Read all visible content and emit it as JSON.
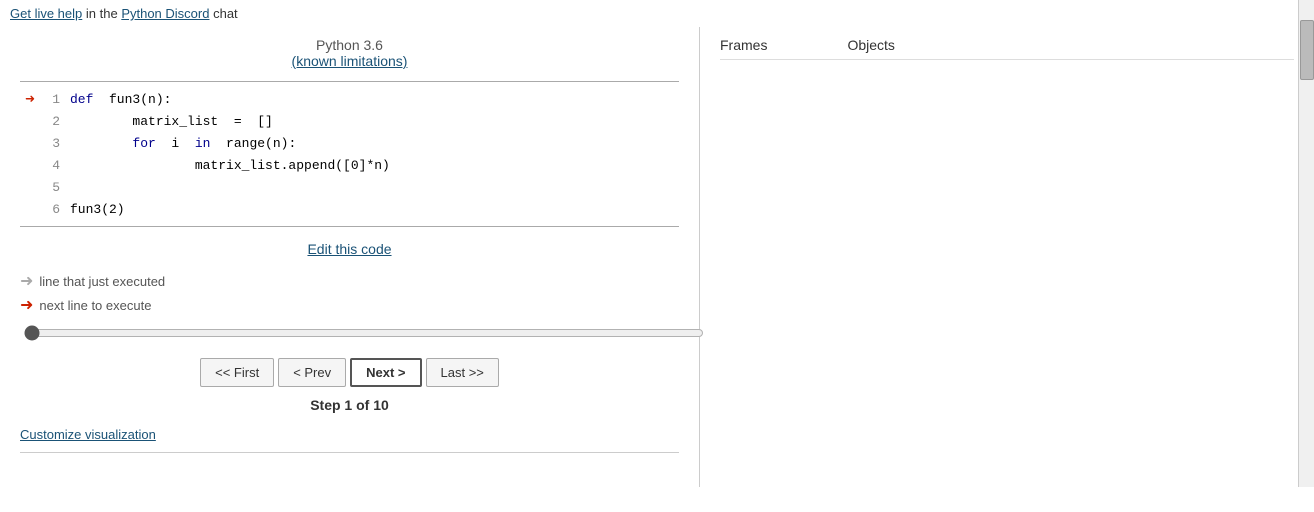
{
  "topbar": {
    "text_prefix": "Get live help",
    "link1": "Get live help",
    "text_middle": " in the ",
    "link2": "Python Discord",
    "text_suffix": " chat"
  },
  "python_header": {
    "version": "Python 3.6",
    "limitations_link": "(known limitations)"
  },
  "code": {
    "lines": [
      {
        "num": "1",
        "arrow": "red",
        "text": "def  fun3(n):"
      },
      {
        "num": "2",
        "arrow": "",
        "text": "        matrix_list  =  []"
      },
      {
        "num": "3",
        "arrow": "",
        "text": "        for  i  in  range(n):"
      },
      {
        "num": "4",
        "arrow": "",
        "text": "                matrix_list.append([0]*n)"
      },
      {
        "num": "5",
        "arrow": "",
        "text": ""
      },
      {
        "num": "6",
        "arrow": "",
        "text": "fun3(2)"
      }
    ]
  },
  "edit_link": "Edit this code",
  "legend": {
    "item1": "line that just executed",
    "item2": "next line to execute"
  },
  "navigation": {
    "first_label": "<< First",
    "prev_label": "< Prev",
    "next_label": "Next >",
    "last_label": "Last >>"
  },
  "step_info": "Step 1 of 10",
  "customize_link": "Customize visualization",
  "right_panel": {
    "frames_label": "Frames",
    "objects_label": "Objects"
  }
}
